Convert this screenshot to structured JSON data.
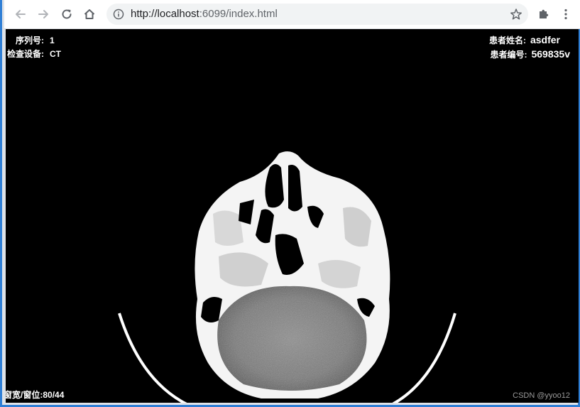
{
  "browser": {
    "url_host": "http://localhost",
    "url_rest": ":6099/index.html"
  },
  "overlay": {
    "series_label": "序列号:",
    "series_value": "1",
    "device_label": "检查设备:",
    "device_value": "CT",
    "patient_name_label": "患者姓名:",
    "patient_name_value": "asdfer",
    "patient_id_label": "患者编号:",
    "patient_id_value": "569835v",
    "window_label": "窗宽/窗位:",
    "window_value": "80/44"
  },
  "watermark": "CSDN @yyoo12",
  "colors": {
    "viewport_bg": "#000000",
    "toolbar_bg": "#ffffff",
    "omnibox_bg": "#f1f3f4",
    "frame_accent": "#2f7fd6"
  },
  "icons": {
    "back": "arrow-left-icon",
    "forward": "arrow-right-icon",
    "reload": "reload-icon",
    "home": "home-icon",
    "info": "info-icon",
    "bookmark": "star-icon",
    "extensions": "puzzle-icon",
    "menu": "kebab-menu-icon"
  }
}
